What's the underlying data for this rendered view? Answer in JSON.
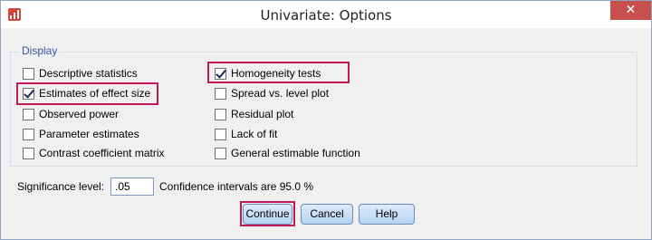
{
  "window": {
    "title": "Univariate: Options",
    "close_symbol": "✕",
    "icon": "spss-app-icon"
  },
  "display": {
    "label": "Display",
    "left_column": [
      {
        "label": "Descriptive statistics",
        "checked": false
      },
      {
        "label": "Estimates of effect size",
        "checked": true
      },
      {
        "label": "Observed power",
        "checked": false
      },
      {
        "label": "Parameter estimates",
        "checked": false
      },
      {
        "label": "Contrast coefficient matrix",
        "checked": false
      }
    ],
    "right_column": [
      {
        "label": "Homogeneity tests",
        "checked": true
      },
      {
        "label": "Spread vs. level plot",
        "checked": false
      },
      {
        "label": "Residual plot",
        "checked": false
      },
      {
        "label": "Lack of fit",
        "checked": false
      },
      {
        "label": "General estimable function",
        "checked": false
      }
    ]
  },
  "significance": {
    "label": "Significance level:",
    "value": ".05",
    "confidence_text": "Confidence intervals are 95.0 %"
  },
  "buttons": {
    "continue": "Continue",
    "cancel": "Cancel",
    "help": "Help"
  },
  "colors": {
    "highlight": "#c2185b",
    "close_button": "#c7504c",
    "group_label": "#3a54a0"
  }
}
